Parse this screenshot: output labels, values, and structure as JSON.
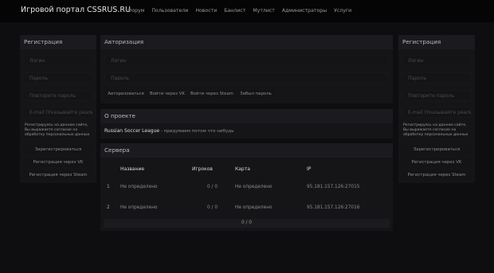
{
  "brand": "Игровой портал CSSRUS.RU",
  "nav": [
    "Форум",
    "Пользователи",
    "Новости",
    "Банлист",
    "Мутлист",
    "Администраторы",
    "Услуги"
  ],
  "left": {
    "title": "Регистрация",
    "login_placeholder": "Логин",
    "password_placeholder": "Пароль",
    "password2_placeholder": "Повторите пароль",
    "email_placeholder": "E-mail (Указывайте реальный)",
    "consent": "Регистрируясь на данном сайте, Вы выражаете согласие на обработку персональных данных",
    "buttons": [
      "Зарегистрироваться",
      "Регистрация через VK",
      "Регистрация через Steam"
    ]
  },
  "right": {
    "title": "Регистрация",
    "login_placeholder": "Логин",
    "password_placeholder": "Пароль",
    "password2_placeholder": "Повторите пароль",
    "email_placeholder": "E-mail (Указывайте реальный)",
    "consent": "Регистрируясь на данном сайте, Вы выражаете согласие на обработку персональных данных",
    "buttons": [
      "Зарегистрироваться",
      "Регистрация через VK",
      "Регистрация через Steam"
    ]
  },
  "auth": {
    "title": "Авторизация",
    "login_placeholder": "Логин",
    "password_placeholder": "Пароль",
    "buttons": [
      "Авторизоваться",
      "Войти через VK",
      "Войти через Steam",
      "Забыл пароль"
    ]
  },
  "about": {
    "title": "О проекте",
    "project_name": "Russian Soccer League",
    "project_desc": " - придумаем потом что нибудь"
  },
  "servers": {
    "title": "Сервера",
    "headers": [
      "Название",
      "Игроков",
      "Карта",
      "IP"
    ],
    "rows": [
      {
        "num": "1",
        "name": "Не определено",
        "players": "0 / 0",
        "map": "Не определено",
        "ip": "95.181.157.126:27015"
      },
      {
        "num": "2",
        "name": "Не определено",
        "players": "0 / 0",
        "map": "Не определено",
        "ip": "95.181.157.126:27016"
      }
    ],
    "total": "0 / 0"
  }
}
